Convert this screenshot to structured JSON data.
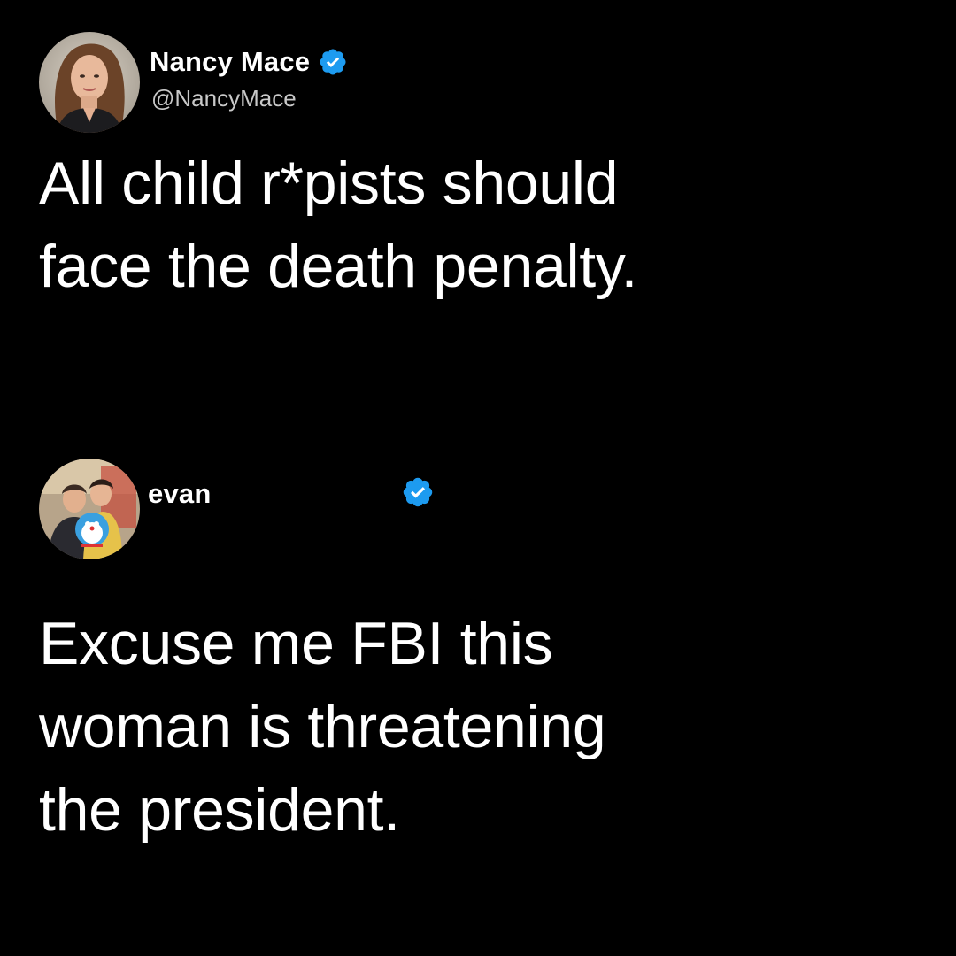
{
  "tweets": [
    {
      "display_name": "Nancy Mace",
      "handle": "@NancyMace",
      "verified_icon": "verified-badge-icon",
      "avatar_icon": "profile-photo-woman",
      "text_lines": [
        "All child r*pists should",
        "face the death penalty."
      ]
    },
    {
      "display_name": "evan",
      "verified_icon": "verified-badge-icon",
      "avatar_icon": "profile-photo-group-with-plush-toy",
      "text_lines": [
        "Excuse me FBI this",
        "woman is threatening",
        "the president."
      ]
    }
  ],
  "colors": {
    "background": "#000000",
    "text": "#ffffff",
    "handle": "#c8c8c8",
    "verified": "#1d9bf0"
  }
}
